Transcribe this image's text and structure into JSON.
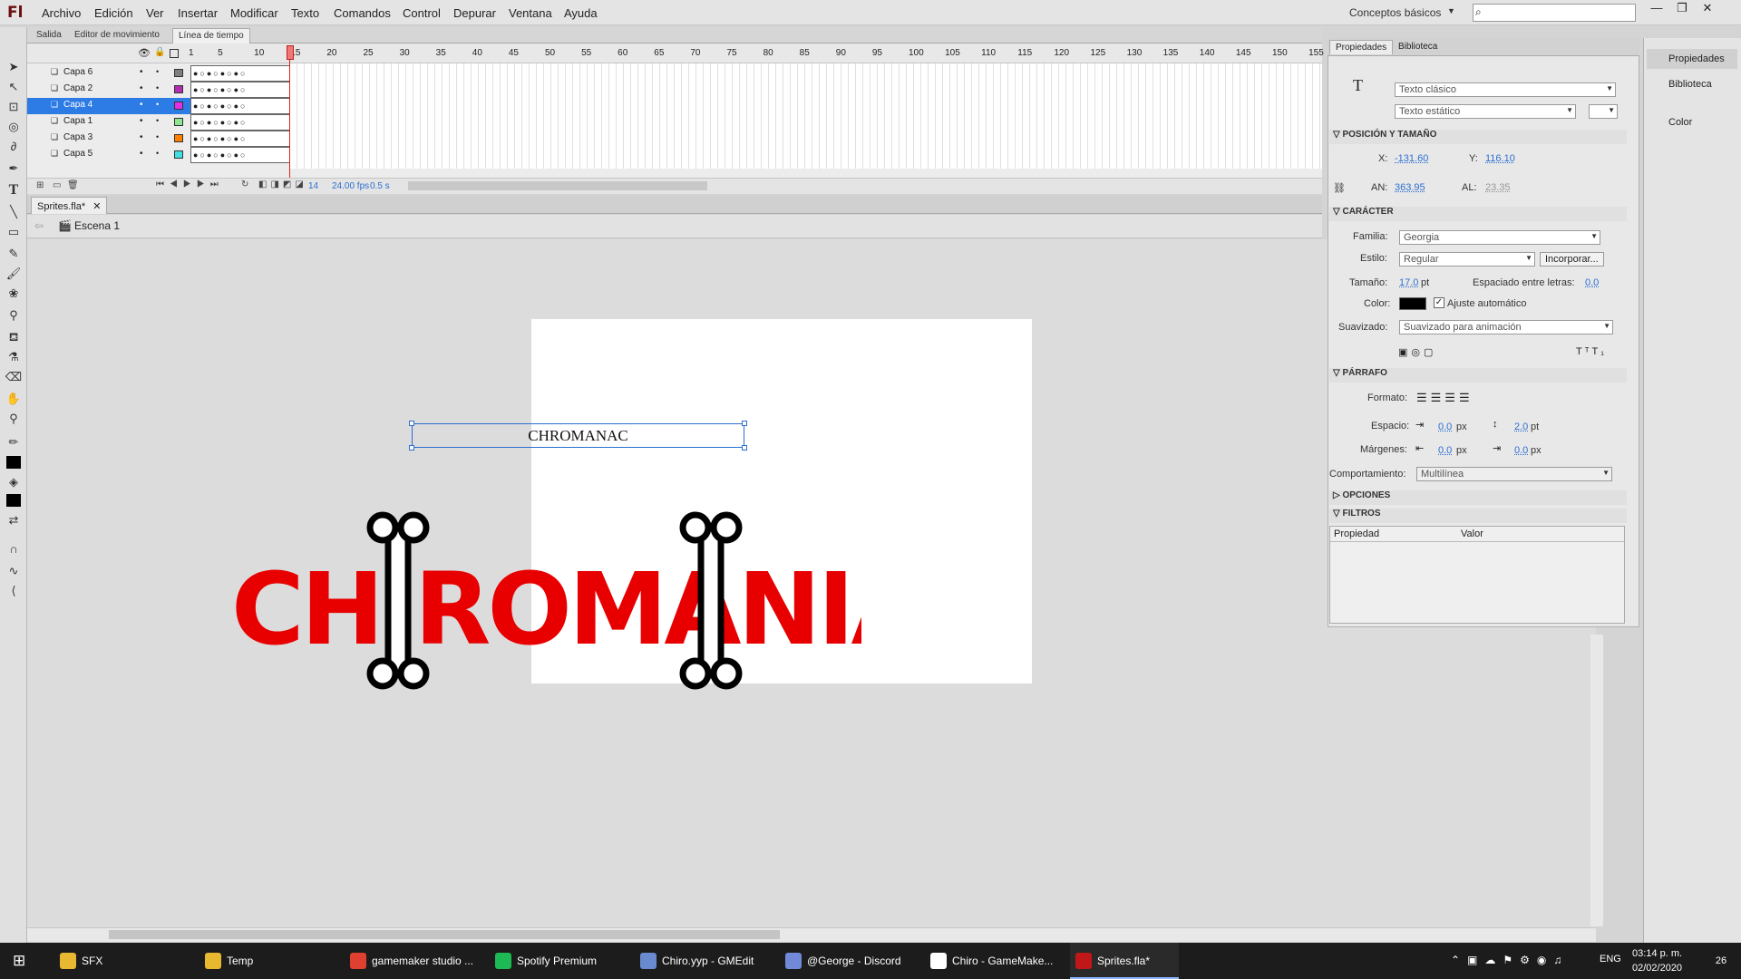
{
  "app": {
    "logo": "Fl"
  },
  "menu": [
    "Archivo",
    "Edición",
    "Ver",
    "Insertar",
    "Modificar",
    "Texto",
    "Comandos",
    "Control",
    "Depurar",
    "Ventana",
    "Ayuda"
  ],
  "workspace": "Conceptos básicos",
  "timeline": {
    "tabs": [
      "Salida",
      "Editor de movimiento",
      "Línea de tiempo"
    ],
    "active_tab": "Línea de tiempo",
    "ruler": [
      "1",
      "5",
      "10",
      "15",
      "20",
      "25",
      "30",
      "35",
      "40",
      "45",
      "50",
      "55",
      "60",
      "65",
      "70",
      "75",
      "80",
      "85",
      "90",
      "95",
      "100",
      "105",
      "110",
      "115",
      "120",
      "125",
      "130",
      "135",
      "140",
      "145",
      "150",
      "155"
    ],
    "layers": [
      {
        "name": "Capa 6",
        "color": "#7f7f7f"
      },
      {
        "name": "Capa 2",
        "color": "#b32db3"
      },
      {
        "name": "Capa 4",
        "color": "#e52ee5"
      },
      {
        "name": "Capa 1",
        "color": "#8fe58f"
      },
      {
        "name": "Capa 3",
        "color": "#ff8000"
      },
      {
        "name": "Capa 5",
        "color": "#40e0e0"
      }
    ],
    "selected_layer": "Capa 4",
    "footer": {
      "frame": "14",
      "fps": "24.00 fps",
      "time": "0.5 s"
    }
  },
  "document": {
    "tab": "Sprites.fla*",
    "scene": "Escena 1"
  },
  "stage": {
    "textfield": "CHROMANAC",
    "logo_text": "CHIROMANIAC"
  },
  "properties": {
    "tabs": [
      "Propiedades",
      "Biblioteca"
    ],
    "text_engine": "Texto clásico",
    "text_type": "Texto estático",
    "position_section": "POSICIÓN Y TAMAÑO",
    "x_label": "X:",
    "x": "-131.60",
    "y_label": "Y:",
    "y": "116.10",
    "w_label": "AN:",
    "w": "363.95",
    "h_label": "AL:",
    "h": "23.35",
    "character_section": "CARÁCTER",
    "family_label": "Familia:",
    "family": "Georgia",
    "style_label": "Estilo:",
    "style": "Regular",
    "embed": "Incorporar...",
    "size_label": "Tamaño:",
    "size": "17.0",
    "size_unit": "pt",
    "spacing_label": "Espaciado entre letras:",
    "spacing": "0.0",
    "color_label": "Color:",
    "autokern": "Ajuste automático",
    "aa_label": "Suavizado:",
    "aa": "Suavizado para animación",
    "paragraph_section": "PÁRRAFO",
    "format_label": "Formato:",
    "space_label": "Espacio:",
    "indent": "0.0",
    "indent_unit": "px",
    "line_spacing": "2.0",
    "line_unit": "pt",
    "margins_label": "Márgenes:",
    "margin_left": "0.0",
    "margin_right": "0.0",
    "margin_unit": "px",
    "behavior_label": "Comportamiento:",
    "behavior": "Multilínea",
    "options_section": "OPCIONES",
    "filters_section": "FILTROS",
    "filter_cols": [
      "Propiedad",
      "Valor"
    ]
  },
  "side_panel": [
    "Propiedades",
    "Biblioteca",
    "Color"
  ],
  "taskbar": {
    "items": [
      {
        "label": "SFX",
        "color": "#e8b830"
      },
      {
        "label": "Temp",
        "color": "#e8b830"
      },
      {
        "label": "gamemaker studio ...",
        "color": "#e04030"
      },
      {
        "label": "Spotify Premium",
        "color": "#1db954"
      },
      {
        "label": "Chiro.yyp - GMEdit",
        "color": "#6a8ad0"
      },
      {
        "label": "@George - Discord",
        "color": "#7289da"
      },
      {
        "label": "Chiro - GameMake...",
        "color": "#ffffff"
      },
      {
        "label": "Sprites.fla*",
        "color": "#c01818"
      }
    ],
    "lang": "ENG",
    "time": "03:14 p. m.",
    "date": "02/02/2020",
    "notifications": "26"
  }
}
